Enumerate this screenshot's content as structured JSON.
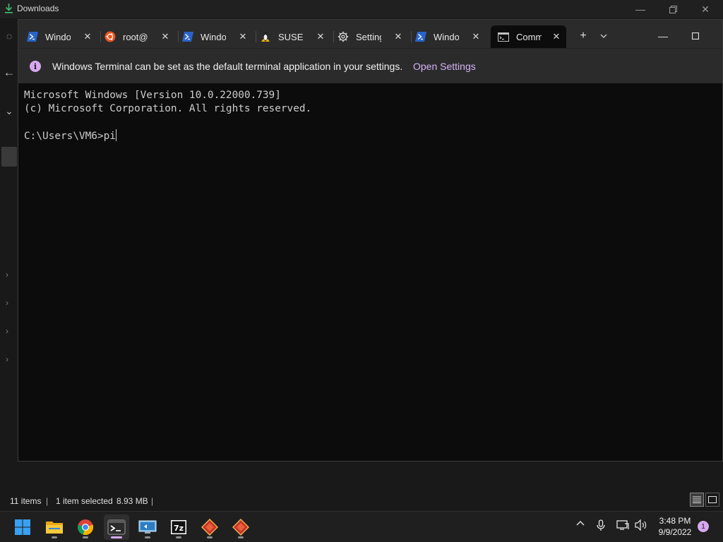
{
  "explorer": {
    "title": "Downloads",
    "status": {
      "items": "11 items",
      "selected": "1 item selected",
      "size": "8.93 MB"
    }
  },
  "terminal": {
    "tabs": [
      {
        "label": "Windows PowerShell",
        "icon": "powershell-icon"
      },
      {
        "label": "root@",
        "icon": "ubuntu-icon"
      },
      {
        "label": "Windows PowerShell",
        "icon": "powershell-icon"
      },
      {
        "label": "SUSE-Linux",
        "icon": "linux-tux-icon"
      },
      {
        "label": "Settings",
        "icon": "gear-icon"
      },
      {
        "label": "Windows PowerShell",
        "icon": "powershell-icon"
      },
      {
        "label": "Command Prompt",
        "icon": "cmd-icon",
        "active": true
      }
    ],
    "new_tab": "+",
    "dropdown": "⌄",
    "infobar": {
      "message": "Windows Terminal can be set as the default terminal application in your settings.",
      "link": "Open Settings"
    },
    "console": {
      "line1": "Microsoft Windows [Version 10.0.22000.739]",
      "line2": "(c) Microsoft Corporation. All rights reserved.",
      "prompt": "C:\\Users\\VM6>",
      "input": "pi"
    }
  },
  "taskbar": {
    "apps": [
      "start-icon",
      "file-explorer-icon",
      "chrome-icon",
      "terminal-icon",
      "remote-desktop-icon",
      "7zip-icon",
      "app-diamond-icon",
      "app-diamond-icon"
    ],
    "time": "3:48 PM",
    "date": "9/9/2022",
    "notifications": "1"
  },
  "colors": {
    "accent": "#d7a8f0",
    "terminal_bg": "#0c0c0c",
    "tabbar_bg": "#2b2b2b"
  }
}
